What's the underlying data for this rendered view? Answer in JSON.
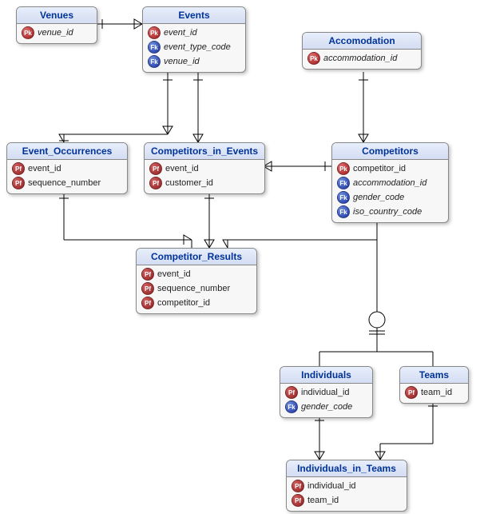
{
  "chart_data": {
    "type": "table",
    "title": "Entity-Relationship Diagram",
    "entities": [
      {
        "name": "Venues",
        "attributes": [
          {
            "key": "PK",
            "name": "venue_id"
          }
        ]
      },
      {
        "name": "Events",
        "attributes": [
          {
            "key": "PK",
            "name": "event_id"
          },
          {
            "key": "FK",
            "name": "event_type_code"
          },
          {
            "key": "FK",
            "name": "venue_id"
          }
        ]
      },
      {
        "name": "Accomodation",
        "attributes": [
          {
            "key": "PK",
            "name": "accommodation_id"
          }
        ]
      },
      {
        "name": "Event_Occurrences",
        "attributes": [
          {
            "key": "PF",
            "name": "event_id"
          },
          {
            "key": "PF",
            "name": "sequence_number"
          }
        ]
      },
      {
        "name": "Competitors_in_Events",
        "attributes": [
          {
            "key": "PF",
            "name": "event_id"
          },
          {
            "key": "PF",
            "name": "customer_id"
          }
        ]
      },
      {
        "name": "Competitors",
        "attributes": [
          {
            "key": "PK",
            "name": "competitor_id"
          },
          {
            "key": "FK",
            "name": "accommodation_id"
          },
          {
            "key": "FK",
            "name": "gender_code"
          },
          {
            "key": "FK",
            "name": "iso_country_code"
          }
        ]
      },
      {
        "name": "Competitor_Results",
        "attributes": [
          {
            "key": "PF",
            "name": "event_id"
          },
          {
            "key": "PF",
            "name": "sequence_number"
          },
          {
            "key": "PF",
            "name": "competitor_id"
          }
        ]
      },
      {
        "name": "Individuals",
        "attributes": [
          {
            "key": "PF",
            "name": "individual_id"
          },
          {
            "key": "FK",
            "name": "gender_code"
          }
        ]
      },
      {
        "name": "Teams",
        "attributes": [
          {
            "key": "PF",
            "name": "team_id"
          }
        ]
      },
      {
        "name": "Individuals_in_Teams",
        "attributes": [
          {
            "key": "PF",
            "name": "individual_id"
          },
          {
            "key": "PF",
            "name": "team_id"
          }
        ]
      }
    ],
    "relationships": [
      {
        "from": "Events",
        "to": "Venues",
        "type": "many-to-one"
      },
      {
        "from": "Event_Occurrences",
        "to": "Events",
        "type": "many-to-one"
      },
      {
        "from": "Competitors_in_Events",
        "to": "Events",
        "type": "many-to-one"
      },
      {
        "from": "Competitors_in_Events",
        "to": "Competitors",
        "type": "many-to-one"
      },
      {
        "from": "Competitors",
        "to": "Accomodation",
        "type": "many-to-one"
      },
      {
        "from": "Competitor_Results",
        "to": "Event_Occurrences",
        "type": "many-to-one"
      },
      {
        "from": "Competitor_Results",
        "to": "Competitors_in_Events",
        "type": "many-to-one"
      },
      {
        "from": "Competitors",
        "subtype": [
          "Individuals",
          "Teams"
        ],
        "type": "supertype-subtype"
      },
      {
        "from": "Individuals_in_Teams",
        "to": "Individuals",
        "type": "many-to-one"
      },
      {
        "from": "Individuals_in_Teams",
        "to": "Teams",
        "type": "many-to-one"
      }
    ]
  },
  "entities": {
    "venues": {
      "title": "Venues",
      "attrs": [
        {
          "k": "Pk",
          "n": "venue_id"
        }
      ]
    },
    "events": {
      "title": "Events",
      "attrs": [
        {
          "k": "Pk",
          "n": "event_id"
        },
        {
          "k": "Fk",
          "n": "event_type_code"
        },
        {
          "k": "Fk",
          "n": "venue_id"
        }
      ]
    },
    "accom": {
      "title": "Accomodation",
      "attrs": [
        {
          "k": "Pk",
          "n": "accommodation_id"
        }
      ]
    },
    "eocc": {
      "title": "Event_Occurrences",
      "attrs": [
        {
          "k": "Pf",
          "n": "event_id"
        },
        {
          "k": "Pf",
          "n": "sequence_number"
        }
      ]
    },
    "cie": {
      "title": "Competitors_in_Events",
      "attrs": [
        {
          "k": "Pf",
          "n": "event_id"
        },
        {
          "k": "Pf",
          "n": "customer_id"
        }
      ]
    },
    "comp": {
      "title": "Competitors",
      "attrs": [
        {
          "k": "Pk",
          "n": "competitor_id"
        },
        {
          "k": "Fk",
          "n": "accommodation_id"
        },
        {
          "k": "Fk",
          "n": "gender_code"
        },
        {
          "k": "Fk",
          "n": "iso_country_code"
        }
      ]
    },
    "cres": {
      "title": "Competitor_Results",
      "attrs": [
        {
          "k": "Pf",
          "n": "event_id"
        },
        {
          "k": "Pf",
          "n": "sequence_number"
        },
        {
          "k": "Pf",
          "n": "competitor_id"
        }
      ]
    },
    "indiv": {
      "title": "Individuals",
      "attrs": [
        {
          "k": "Pf",
          "n": "individual_id"
        },
        {
          "k": "Fk",
          "n": "gender_code"
        }
      ]
    },
    "teams": {
      "title": "Teams",
      "attrs": [
        {
          "k": "Pf",
          "n": "team_id"
        }
      ]
    },
    "iit": {
      "title": "Individuals_in_Teams",
      "attrs": [
        {
          "k": "Pf",
          "n": "individual_id"
        },
        {
          "k": "Pf",
          "n": "team_id"
        }
      ]
    }
  }
}
